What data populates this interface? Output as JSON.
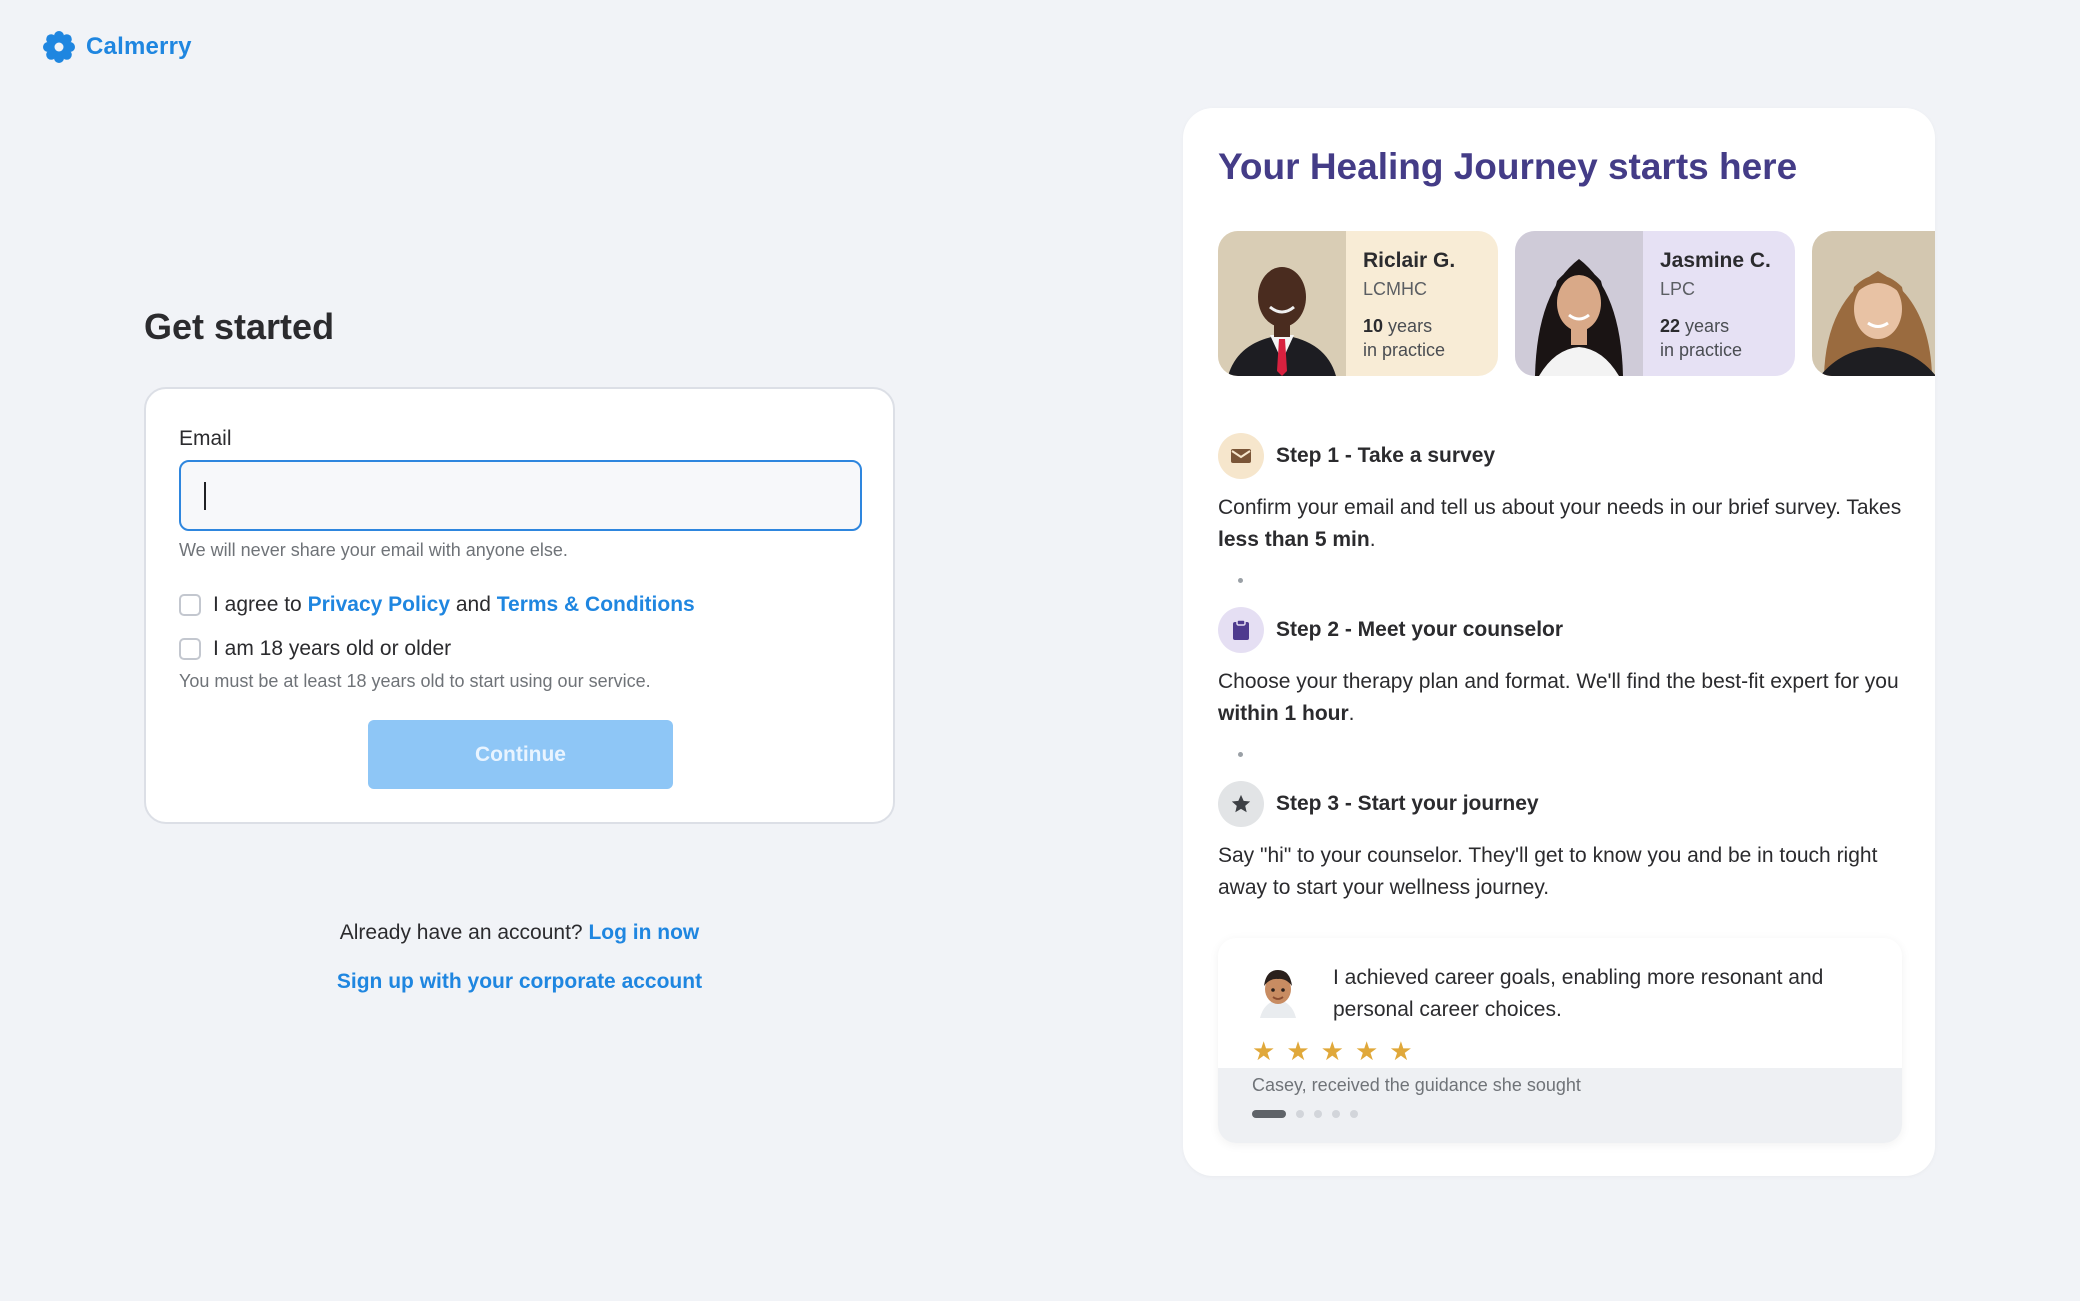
{
  "brand": {
    "name": "Calmerry",
    "color": "#1f86e0"
  },
  "left": {
    "title": "Get started",
    "email_label": "Email",
    "email_value": "",
    "email_hint": "We will never share your email with anyone else.",
    "agree_prefix": "I agree to",
    "privacy_link": "Privacy Policy",
    "agree_and": "and",
    "terms_link": "Terms & Conditions",
    "age_label": "I am 18 years old or older",
    "age_hint": "You must be at least 18 years old to start using our service.",
    "continue_label": "Continue",
    "already_text": "Already have an account?",
    "login_link": "Log in now",
    "corporate_link": "Sign up with your corporate account"
  },
  "right": {
    "title": "Your Healing Journey starts here",
    "counselors": [
      {
        "name": "Riclair G.",
        "cred": "LCMHC",
        "years": "10",
        "years_suffix": "years",
        "practice": "in practice"
      },
      {
        "name": "Jasmine C.",
        "cred": "LPC",
        "years": "22",
        "years_suffix": "years",
        "practice": "in practice"
      }
    ],
    "steps": [
      {
        "title": "Step 1 - Take a survey",
        "text_a": "Confirm your email and tell us about your needs in our brief survey. Takes ",
        "text_b": "less than 5 min",
        "text_c": ".",
        "icon": "envelope-icon"
      },
      {
        "title": "Step 2 - Meet your counselor",
        "text_a": "Choose your therapy plan and format. We'll find the best-fit expert for you ",
        "text_b": "within 1 hour",
        "text_c": ".",
        "icon": "clipboard-icon"
      },
      {
        "title": "Step 3 - Start your journey",
        "text_a": "Say \"hi\" to your counselor. They'll get to know you and be in touch right away to start your wellness journey.",
        "text_b": "",
        "text_c": "",
        "icon": "star-icon"
      }
    ],
    "review": {
      "quote": "I achieved career goals, enabling more resonant and personal career choices.",
      "rating": 5,
      "reviewer": "Casey, received the guidance she sought",
      "pages": 5,
      "active_page": 1
    }
  },
  "colors": {
    "accent": "#1f86e0",
    "panel_title": "#443c87",
    "star": "#e0a83a",
    "button_disabled": "#8ec6f6"
  }
}
